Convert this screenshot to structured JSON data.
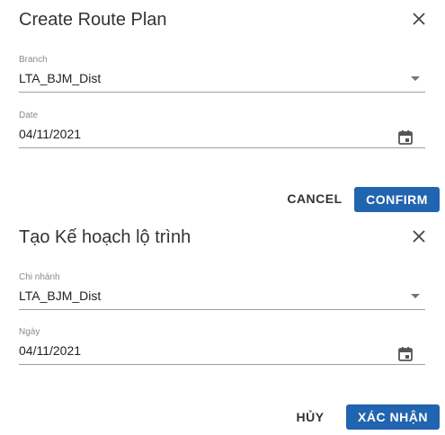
{
  "dialogs": [
    {
      "title": "Create Route Plan",
      "branch": {
        "label": "Branch",
        "value": "LTA_BJM_Dist"
      },
      "date": {
        "label": "Date",
        "value": "04/11/2021"
      },
      "cancel_label": "CANCEL",
      "confirm_label": "CONFIRM"
    },
    {
      "title": "Tạo Kế hoạch lộ trình",
      "branch": {
        "label": "Chi nhánh",
        "value": "LTA_BJM_Dist"
      },
      "date": {
        "label": "Ngày",
        "value": "04/11/2021"
      },
      "cancel_label": "HỦY",
      "confirm_label": "XÁC NHẬN"
    }
  ],
  "colors": {
    "primary": "#2164b0",
    "text": "#333333",
    "label": "#8a8a8a",
    "underline": "#9e9e9e"
  },
  "icons": {
    "close": "close-icon",
    "dropdown": "chevron-down-icon",
    "date": "calendar-icon"
  }
}
